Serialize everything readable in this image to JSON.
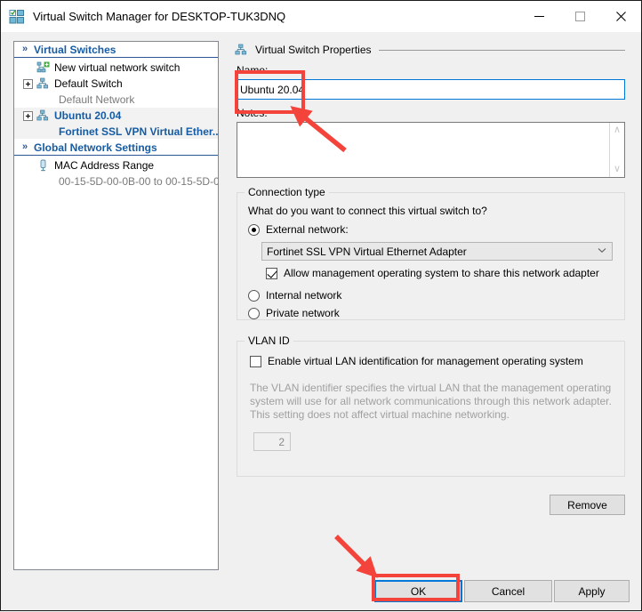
{
  "window": {
    "title": "Virtual Switch Manager for DESKTOP-TUK3DNQ",
    "icon": "hyper-v-switch-icon",
    "minimize": "—",
    "maximize": "□",
    "close": "✕"
  },
  "sidebar": {
    "sections": [
      {
        "label": "Virtual Switches",
        "chevron": "«",
        "rows": [
          {
            "label": "New virtual network switch",
            "icon": "new-switch-icon",
            "expander": false,
            "selected": false,
            "sub": null
          },
          {
            "label": "Default Switch",
            "icon": "switch-icon",
            "expander": true,
            "selected": false,
            "sub": "Default Network"
          },
          {
            "label": "Ubuntu 20.04",
            "icon": "switch-icon",
            "expander": true,
            "selected": true,
            "sub": "Fortinet SSL VPN Virtual Ether..."
          }
        ]
      },
      {
        "label": "Global Network Settings",
        "chevron": "«",
        "rows": [
          {
            "label": "MAC Address Range",
            "icon": "mac-range-icon",
            "expander": false,
            "selected": false,
            "sub": "00-15-5D-00-0B-00 to 00-15-5D-0..."
          }
        ]
      }
    ]
  },
  "properties": {
    "header": "Virtual Switch Properties",
    "name_label": "Name:",
    "name_value": "Ubuntu 20.04",
    "notes_label": "Notes:",
    "notes_value": "",
    "scroll_up": "∧",
    "scroll_down": "∨"
  },
  "connection": {
    "legend": "Connection type",
    "question": "What do you want to connect this virtual switch to?",
    "external_label": "External network:",
    "external_selected": true,
    "adapter_value": "Fortinet SSL VPN Virtual Ethernet Adapter",
    "adapter_arrow": "⌄",
    "share_label": "Allow management operating system to share this network adapter",
    "share_checked": true,
    "internal_label": "Internal network",
    "internal_selected": false,
    "private_label": "Private network",
    "private_selected": false
  },
  "vlan": {
    "legend": "VLAN ID",
    "enable_label": "Enable virtual LAN identification for management operating system",
    "enable_checked": false,
    "description": "The VLAN identifier specifies the virtual LAN that the management operating system will use for all network communications through this network adapter. This setting does not affect virtual machine networking.",
    "id_value": "2"
  },
  "buttons": {
    "remove": "Remove",
    "ok": "OK",
    "cancel": "Cancel",
    "apply": "Apply"
  },
  "annotations": {
    "accent_color": "#f4433a",
    "focus_color": "#0078d7",
    "name_box": "highlight-rect-name-field",
    "ok_box": "highlight-rect-ok-button",
    "arrow_to_name": "arrow-pointing-to-name-field",
    "arrow_to_ok": "arrow-pointing-to-ok-button"
  }
}
